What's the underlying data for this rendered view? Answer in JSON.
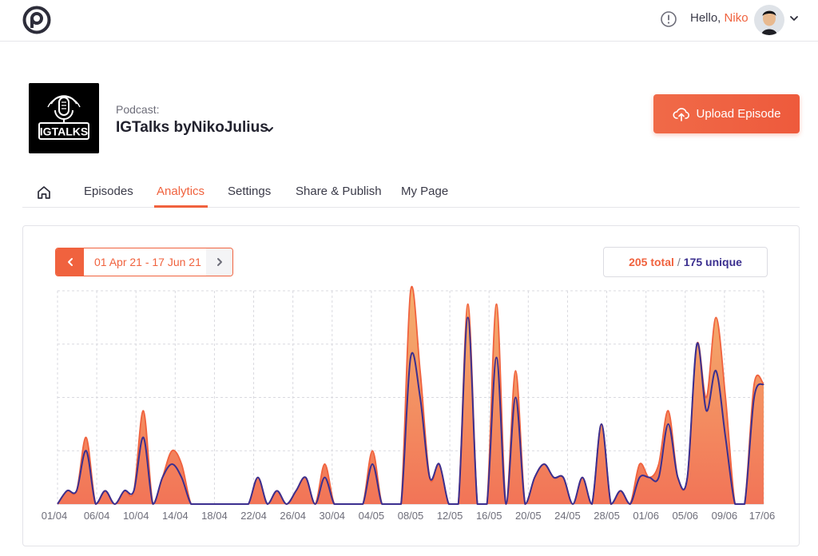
{
  "user": {
    "greeting": "Hello,",
    "name": "Niko"
  },
  "icons": {
    "logo": "podcast-p-logo",
    "alert": "exclamation-circle-icon",
    "avatar": "user-avatar",
    "home": "home-icon",
    "upload": "cloud-upload-icon"
  },
  "podcast": {
    "label": "Podcast:",
    "name": "IGTalks byNikoJulius",
    "cover_text": "IGTALKS"
  },
  "upload_button": {
    "label": "Upload Episode"
  },
  "tabs": [
    {
      "label": "Episodes"
    },
    {
      "label": "Analytics",
      "active": true
    },
    {
      "label": "Settings"
    },
    {
      "label": "Share & Publish"
    },
    {
      "label": "My Page"
    }
  ],
  "analytics": {
    "date_range": "01 Apr 21 - 17 Jun 21",
    "total_label": "205 total",
    "separator": "/",
    "unique_label": "175 unique"
  },
  "colors": {
    "accent": "#f0623e",
    "unique": "#3b2f8f",
    "fill_top": "#f5b06e",
    "fill_bottom": "#f27457"
  },
  "chart_data": {
    "type": "area",
    "x_tick_labels": [
      "01/04",
      "06/04",
      "10/04",
      "14/04",
      "18/04",
      "22/04",
      "26/04",
      "30/04",
      "04/05",
      "08/05",
      "12/05",
      "16/05",
      "20/05",
      "24/05",
      "28/05",
      "01/06",
      "05/06",
      "09/06",
      "17/06"
    ],
    "ylim": [
      0,
      8
    ],
    "grid": true,
    "series": [
      {
        "points": [
          [
            0,
            0
          ],
          [
            1,
            0.5
          ],
          [
            2,
            0.5
          ],
          [
            3,
            2.5
          ],
          [
            4,
            0
          ],
          [
            5,
            0.5
          ],
          [
            6,
            0
          ],
          [
            7,
            0.5
          ],
          [
            8,
            0.5
          ],
          [
            9,
            3.5
          ],
          [
            10,
            0
          ],
          [
            11,
            1
          ],
          [
            12,
            2
          ],
          [
            13,
            1.5
          ],
          [
            14,
            0
          ],
          [
            15,
            0
          ],
          [
            16,
            0
          ],
          [
            17,
            0
          ],
          [
            18,
            0
          ],
          [
            19,
            0
          ],
          [
            20,
            0
          ],
          [
            21,
            1
          ],
          [
            22,
            0
          ],
          [
            23,
            0.5
          ],
          [
            24,
            0
          ],
          [
            25,
            0.5
          ],
          [
            26,
            1
          ],
          [
            27,
            0
          ],
          [
            28,
            1.5
          ],
          [
            29,
            0
          ],
          [
            30,
            0
          ],
          [
            31,
            0
          ],
          [
            32,
            0
          ],
          [
            33,
            2
          ],
          [
            34,
            0
          ],
          [
            35,
            0
          ],
          [
            36,
            0
          ],
          [
            37,
            8
          ],
          [
            38,
            5
          ],
          [
            39,
            1
          ],
          [
            40,
            1.5
          ],
          [
            41,
            0
          ],
          [
            42,
            0
          ],
          [
            43,
            7.5
          ],
          [
            44,
            0
          ],
          [
            45,
            0
          ],
          [
            46,
            7.5
          ],
          [
            47,
            0
          ],
          [
            48,
            5
          ],
          [
            49,
            0
          ],
          [
            50,
            1
          ],
          [
            51,
            1.5
          ],
          [
            52,
            1
          ],
          [
            53,
            1
          ],
          [
            54,
            0
          ],
          [
            55,
            1
          ],
          [
            56,
            0
          ],
          [
            57,
            3
          ],
          [
            58,
            0
          ],
          [
            59,
            0.5
          ],
          [
            60,
            0
          ],
          [
            61,
            1.5
          ],
          [
            62,
            1
          ],
          [
            63,
            1.5
          ],
          [
            64,
            3.5
          ],
          [
            65,
            1
          ],
          [
            66,
            1
          ],
          [
            67,
            6
          ],
          [
            68,
            4
          ],
          [
            69,
            7
          ],
          [
            70,
            4
          ],
          [
            71,
            0
          ],
          [
            72,
            0
          ],
          [
            73,
            4.5
          ],
          [
            74,
            4.5
          ]
        ]
      },
      {
        "points": [
          [
            0,
            0
          ],
          [
            1,
            0.5
          ],
          [
            2,
            0.5
          ],
          [
            3,
            2
          ],
          [
            4,
            0
          ],
          [
            5,
            0.5
          ],
          [
            6,
            0
          ],
          [
            7,
            0.5
          ],
          [
            8,
            0.5
          ],
          [
            9,
            2.5
          ],
          [
            10,
            0
          ],
          [
            11,
            1
          ],
          [
            12,
            1.5
          ],
          [
            13,
            1
          ],
          [
            14,
            0
          ],
          [
            15,
            0
          ],
          [
            16,
            0
          ],
          [
            17,
            0
          ],
          [
            18,
            0
          ],
          [
            19,
            0
          ],
          [
            20,
            0
          ],
          [
            21,
            1
          ],
          [
            22,
            0
          ],
          [
            23,
            0.5
          ],
          [
            24,
            0
          ],
          [
            25,
            0.5
          ],
          [
            26,
            1
          ],
          [
            27,
            0
          ],
          [
            28,
            1
          ],
          [
            29,
            0
          ],
          [
            30,
            0
          ],
          [
            31,
            0
          ],
          [
            32,
            0
          ],
          [
            33,
            1.5
          ],
          [
            34,
            0
          ],
          [
            35,
            0
          ],
          [
            36,
            0
          ],
          [
            37,
            5.5
          ],
          [
            38,
            4
          ],
          [
            39,
            1
          ],
          [
            40,
            1.5
          ],
          [
            41,
            0
          ],
          [
            42,
            0
          ],
          [
            43,
            7
          ],
          [
            44,
            0
          ],
          [
            45,
            0
          ],
          [
            46,
            5.5
          ],
          [
            47,
            0
          ],
          [
            48,
            4
          ],
          [
            49,
            0
          ],
          [
            50,
            1
          ],
          [
            51,
            1.5
          ],
          [
            52,
            1
          ],
          [
            53,
            1
          ],
          [
            54,
            0
          ],
          [
            55,
            1
          ],
          [
            56,
            0
          ],
          [
            57,
            3
          ],
          [
            58,
            0
          ],
          [
            59,
            0.5
          ],
          [
            60,
            0
          ],
          [
            61,
            1
          ],
          [
            62,
            1
          ],
          [
            63,
            1
          ],
          [
            64,
            3
          ],
          [
            65,
            1
          ],
          [
            66,
            1
          ],
          [
            67,
            6
          ],
          [
            68,
            3.5
          ],
          [
            69,
            5
          ],
          [
            70,
            2.5
          ],
          [
            71,
            0
          ],
          [
            72,
            0
          ],
          [
            73,
            4
          ],
          [
            74,
            4.5
          ]
        ]
      }
    ]
  }
}
